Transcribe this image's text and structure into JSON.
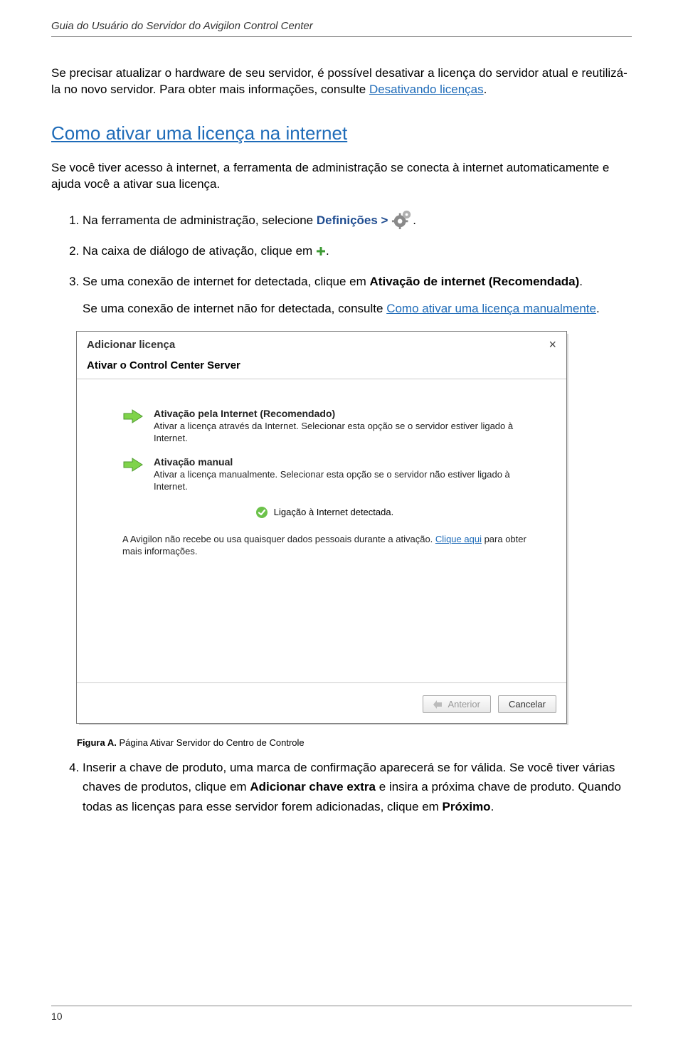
{
  "header": {
    "title": "Guia do Usuário do Servidor do Avigilon Control Center"
  },
  "intro": {
    "p1a": "Se precisar atualizar o hardware de seu servidor, é possível desativar a licença do servidor atual e reutilizá-la no novo servidor. Para obter mais informações, consulte ",
    "p1_link": "Desativando licenças",
    "p1b": "."
  },
  "section": {
    "heading": "Como ativar uma licença na internet",
    "lead": "Se você tiver acesso à internet, a ferramenta de administração se conecta à internet automaticamente e ajuda você a ativar sua licença."
  },
  "steps": {
    "s1a": "Na ferramenta de administração, selecione ",
    "s1_def": "Definições >",
    "s1b": ".",
    "s2a": "Na caixa de diálogo de ativação, clique em ",
    "s2b": ".",
    "s3a": "Se uma conexão de internet for detectada, clique em ",
    "s3_bold": "Ativação de internet (Recomendada)",
    "s3b": ".",
    "s3_note_a": "Se uma conexão de internet não for detectada, consulte ",
    "s3_link": "Como ativar uma licença manualmente",
    "s3_note_b": "."
  },
  "dialog": {
    "title": "Adicionar licença",
    "subtitle": "Ativar o Control Center Server",
    "opt1": {
      "title": "Ativação pela Internet (Recomendado)",
      "desc": "Ativar a licença através da Internet. Selecionar esta opção se o servidor estiver ligado à Internet."
    },
    "opt2": {
      "title": "Ativação manual",
      "desc": "Ativar a licença manualmente. Selecionar esta opção se o servidor não estiver ligado à Internet."
    },
    "status": "Ligação à Internet detectada.",
    "privacy_a": "A Avigilon não recebe ou usa quaisquer dados pessoais durante a ativação. ",
    "privacy_link": "Clique aqui",
    "privacy_b": " para obter mais informações.",
    "btn_prev": "Anterior",
    "btn_cancel": "Cancelar"
  },
  "figure": {
    "label": "Figura A.",
    "caption": "Página Ativar Servidor do Centro de Controle"
  },
  "step4": {
    "a": "Inserir a chave de produto, uma marca de confirmação aparecerá se for válida. Se você tiver várias chaves de produtos, clique em ",
    "bold1": "Adicionar chave extra",
    "b": " e insira a próxima chave de produto. Quando todas as licenças para esse servidor forem adicionadas, clique em ",
    "bold2": "Próximo",
    "c": "."
  },
  "footer": {
    "page": "10"
  }
}
